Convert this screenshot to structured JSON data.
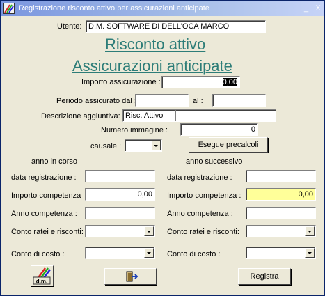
{
  "window": {
    "title": "Registrazione risconto attivo per assicurazioni anticipate",
    "minimize": "_",
    "close": "X"
  },
  "form": {
    "utente_label": "Utente:",
    "utente_value": "D.M. SOFTWARE DI DELL'OCA MARCO",
    "heading1": "Risconto attivo",
    "heading2": "Assicurazioni anticipate",
    "importo_label": "Importo assicurazione :",
    "importo_value": "0,00",
    "periodo_label": "Periodo assicurato dal :",
    "periodo_dal": "",
    "al_label": "al :",
    "periodo_al": "",
    "descrizione_label": "Descrizione aggiuntiva:",
    "descrizione_value": "Risc. Attivo",
    "numero_label": "Numero immagine :",
    "numero_value": "0",
    "causale_label": "causale :",
    "causale_value": "",
    "esegue_button": "Esegue precalcoli"
  },
  "sections": {
    "left_title": "anno in corso",
    "right_title": "anno successivo"
  },
  "left": {
    "data_label": "data registrazione :",
    "data_value": "",
    "importo_label": "Importo competenza",
    "importo_value": "0,00",
    "anno_label": "Anno competenza :",
    "anno_value": "",
    "conto_ratei_label": "Conto ratei e risconti:",
    "conto_ratei_value": "",
    "conto_costo_label": "Conto di costo :",
    "conto_costo_value": ""
  },
  "right": {
    "data_label": "data registrazione :",
    "data_value": "",
    "importo_label": "Importo competenza :",
    "importo_value": "0,00",
    "anno_label": "Anno competenza :",
    "anno_value": "",
    "conto_ratei_label": "Conto ratei e risconti:",
    "conto_ratei_value": "",
    "conto_costo_label": "Conto di costo :",
    "conto_costo_value": ""
  },
  "buttons": {
    "logo_text": "d.m.",
    "registra": "Registra"
  }
}
